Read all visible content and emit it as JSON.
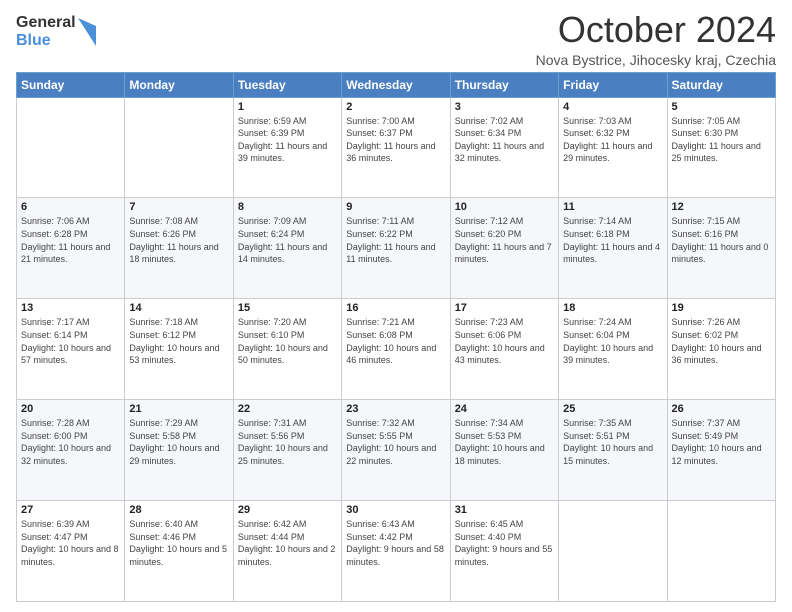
{
  "header": {
    "logo": {
      "line1": "General",
      "line2": "Blue"
    },
    "title": "October 2024",
    "subtitle": "Nova Bystrice, Jihocesky kraj, Czechia"
  },
  "calendar": {
    "days_of_week": [
      "Sunday",
      "Monday",
      "Tuesday",
      "Wednesday",
      "Thursday",
      "Friday",
      "Saturday"
    ],
    "weeks": [
      [
        {
          "day": "",
          "info": ""
        },
        {
          "day": "",
          "info": ""
        },
        {
          "day": "1",
          "info": "Sunrise: 6:59 AM\nSunset: 6:39 PM\nDaylight: 11 hours and 39 minutes."
        },
        {
          "day": "2",
          "info": "Sunrise: 7:00 AM\nSunset: 6:37 PM\nDaylight: 11 hours and 36 minutes."
        },
        {
          "day": "3",
          "info": "Sunrise: 7:02 AM\nSunset: 6:34 PM\nDaylight: 11 hours and 32 minutes."
        },
        {
          "day": "4",
          "info": "Sunrise: 7:03 AM\nSunset: 6:32 PM\nDaylight: 11 hours and 29 minutes."
        },
        {
          "day": "5",
          "info": "Sunrise: 7:05 AM\nSunset: 6:30 PM\nDaylight: 11 hours and 25 minutes."
        }
      ],
      [
        {
          "day": "6",
          "info": "Sunrise: 7:06 AM\nSunset: 6:28 PM\nDaylight: 11 hours and 21 minutes."
        },
        {
          "day": "7",
          "info": "Sunrise: 7:08 AM\nSunset: 6:26 PM\nDaylight: 11 hours and 18 minutes."
        },
        {
          "day": "8",
          "info": "Sunrise: 7:09 AM\nSunset: 6:24 PM\nDaylight: 11 hours and 14 minutes."
        },
        {
          "day": "9",
          "info": "Sunrise: 7:11 AM\nSunset: 6:22 PM\nDaylight: 11 hours and 11 minutes."
        },
        {
          "day": "10",
          "info": "Sunrise: 7:12 AM\nSunset: 6:20 PM\nDaylight: 11 hours and 7 minutes."
        },
        {
          "day": "11",
          "info": "Sunrise: 7:14 AM\nSunset: 6:18 PM\nDaylight: 11 hours and 4 minutes."
        },
        {
          "day": "12",
          "info": "Sunrise: 7:15 AM\nSunset: 6:16 PM\nDaylight: 11 hours and 0 minutes."
        }
      ],
      [
        {
          "day": "13",
          "info": "Sunrise: 7:17 AM\nSunset: 6:14 PM\nDaylight: 10 hours and 57 minutes."
        },
        {
          "day": "14",
          "info": "Sunrise: 7:18 AM\nSunset: 6:12 PM\nDaylight: 10 hours and 53 minutes."
        },
        {
          "day": "15",
          "info": "Sunrise: 7:20 AM\nSunset: 6:10 PM\nDaylight: 10 hours and 50 minutes."
        },
        {
          "day": "16",
          "info": "Sunrise: 7:21 AM\nSunset: 6:08 PM\nDaylight: 10 hours and 46 minutes."
        },
        {
          "day": "17",
          "info": "Sunrise: 7:23 AM\nSunset: 6:06 PM\nDaylight: 10 hours and 43 minutes."
        },
        {
          "day": "18",
          "info": "Sunrise: 7:24 AM\nSunset: 6:04 PM\nDaylight: 10 hours and 39 minutes."
        },
        {
          "day": "19",
          "info": "Sunrise: 7:26 AM\nSunset: 6:02 PM\nDaylight: 10 hours and 36 minutes."
        }
      ],
      [
        {
          "day": "20",
          "info": "Sunrise: 7:28 AM\nSunset: 6:00 PM\nDaylight: 10 hours and 32 minutes."
        },
        {
          "day": "21",
          "info": "Sunrise: 7:29 AM\nSunset: 5:58 PM\nDaylight: 10 hours and 29 minutes."
        },
        {
          "day": "22",
          "info": "Sunrise: 7:31 AM\nSunset: 5:56 PM\nDaylight: 10 hours and 25 minutes."
        },
        {
          "day": "23",
          "info": "Sunrise: 7:32 AM\nSunset: 5:55 PM\nDaylight: 10 hours and 22 minutes."
        },
        {
          "day": "24",
          "info": "Sunrise: 7:34 AM\nSunset: 5:53 PM\nDaylight: 10 hours and 18 minutes."
        },
        {
          "day": "25",
          "info": "Sunrise: 7:35 AM\nSunset: 5:51 PM\nDaylight: 10 hours and 15 minutes."
        },
        {
          "day": "26",
          "info": "Sunrise: 7:37 AM\nSunset: 5:49 PM\nDaylight: 10 hours and 12 minutes."
        }
      ],
      [
        {
          "day": "27",
          "info": "Sunrise: 6:39 AM\nSunset: 4:47 PM\nDaylight: 10 hours and 8 minutes."
        },
        {
          "day": "28",
          "info": "Sunrise: 6:40 AM\nSunset: 4:46 PM\nDaylight: 10 hours and 5 minutes."
        },
        {
          "day": "29",
          "info": "Sunrise: 6:42 AM\nSunset: 4:44 PM\nDaylight: 10 hours and 2 minutes."
        },
        {
          "day": "30",
          "info": "Sunrise: 6:43 AM\nSunset: 4:42 PM\nDaylight: 9 hours and 58 minutes."
        },
        {
          "day": "31",
          "info": "Sunrise: 6:45 AM\nSunset: 4:40 PM\nDaylight: 9 hours and 55 minutes."
        },
        {
          "day": "",
          "info": ""
        },
        {
          "day": "",
          "info": ""
        }
      ]
    ]
  }
}
